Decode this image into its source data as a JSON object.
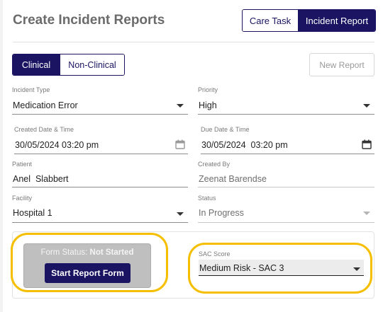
{
  "header": {
    "title": "Create Incident Reports",
    "tabs": [
      {
        "label": "Care Task",
        "active": false
      },
      {
        "label": "Incident Report",
        "active": true
      }
    ]
  },
  "category": {
    "tabs": [
      {
        "label": "Clinical",
        "active": true
      },
      {
        "label": "Non-Clinical",
        "active": false
      }
    ],
    "new_report_label": "New Report"
  },
  "form": {
    "incident_type": {
      "label": "Incident Type",
      "value": "Medication Error"
    },
    "priority": {
      "label": "Priority",
      "value": "High"
    },
    "created_datetime": {
      "label": "Created Date & Time",
      "value": "30/05/2024 03:20 pm"
    },
    "due_datetime": {
      "label": "Due Date & Time",
      "value": "30/05/2024  03:20 pm"
    },
    "patient": {
      "label": "Patient",
      "value": "Anel  Slabbert"
    },
    "created_by": {
      "label": "Created By",
      "value": "Zeenat Barendse"
    },
    "facility": {
      "label": "Facility",
      "value": "Hospital 1"
    },
    "status": {
      "label": "Status",
      "value": "In Progress"
    }
  },
  "report_form": {
    "status_prefix": "Form Status:",
    "status_value": "Not Started",
    "start_button_label": "Start Report Form"
  },
  "sac": {
    "label": "SAC Score",
    "value": "Medium Risk - SAC 3"
  },
  "colors": {
    "primary": "#1a1462",
    "highlight": "#f5bf00",
    "status_box": "#bfbfbf"
  },
  "icons": {
    "dropdown": "chevron-down-icon",
    "calendar": "calendar-icon"
  }
}
